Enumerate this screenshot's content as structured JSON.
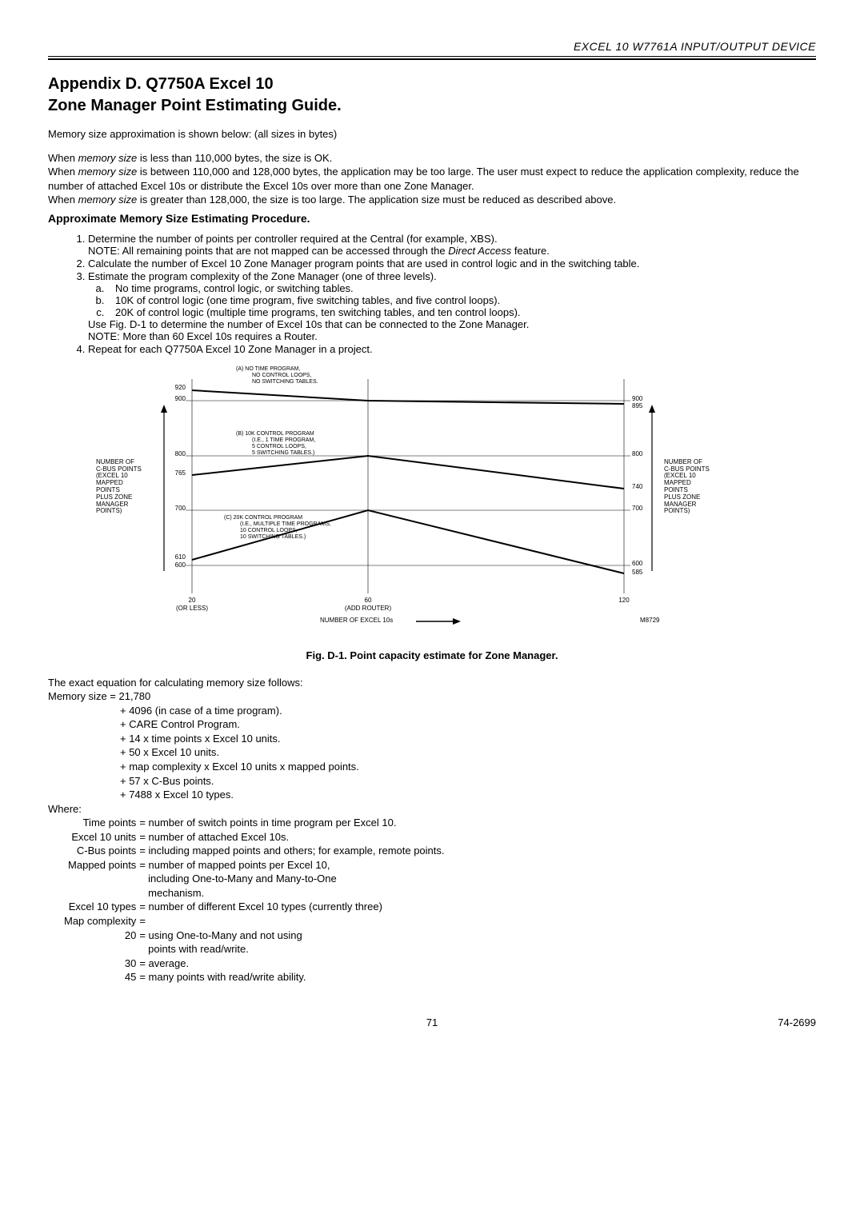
{
  "header": {
    "doc_title": "EXCEL 10 W7761A INPUT/OUTPUT DEVICE"
  },
  "title": {
    "l1": "Appendix D. Q7750A Excel 10",
    "l2": "Zone Manager Point Estimating Guide."
  },
  "intro": "Memory size approximation is shown below: (all sizes in bytes)",
  "mem": {
    "p1a": "When ",
    "p1i": "memory size",
    "p1b": " is less than 110,000 bytes, the size is OK.",
    "p2a": "When ",
    "p2i": "memory size",
    "p2b": " is between 110,000 and 128,000 bytes, the application may be too large. The user must expect to reduce the application complexity, reduce the number of attached Excel 10s or distribute the Excel 10s over more than one Zone Manager.",
    "p3a": "When ",
    "p3i": "memory size",
    "p3b": " is greater than 128,000, the size is too large. The application size must be reduced as described above."
  },
  "subheading": "Approximate Memory Size Estimating Procedure.",
  "steps": {
    "s1": "Determine the number of points per controller required at the Central (for example, XBS).",
    "s1_note_a": "NOTE:   All remaining points that are not mapped can be accessed through the ",
    "s1_note_i": "Direct Access",
    "s1_note_b": " feature.",
    "s2": "Calculate the number of Excel 10 Zone Manager program points that are used in control logic and in the switching table.",
    "s3": "Estimate the program complexity of the Zone Manager (one of three levels).",
    "s3a": "No time programs, control logic, or switching tables.",
    "s3b": "10K of control logic (one time program, five switching tables, and five control loops).",
    "s3c": "20K of control logic (multiple time programs, ten switching tables, and ten control loops).",
    "s3_use": "Use Fig. D-1 to determine the number of Excel 10s that can be connected to the Zone Manager.",
    "s3_note": "NOTE:   More than 60 Excel 10s requires a Router.",
    "s4": "Repeat for each Q7750A Excel 10 Zone Manager in a project."
  },
  "figure_caption": "Fig. D-1. Point capacity estimate for Zone Manager.",
  "equation": {
    "lead": "The exact equation for calculating memory size follows:",
    "l0": "Memory size = 21,780",
    "l1": "+ 4096 (in case of a time program).",
    "l2": "+ CARE Control Program.",
    "l3": "+ 14 x time points x Excel 10 units.",
    "l4": "+ 50 x Excel 10 units.",
    "l5": "+ map complexity x Excel 10 units x mapped points.",
    "l6": "+ 57 x C-Bus points.",
    "l7": "+ 7488 x Excel 10 types."
  },
  "where_heading": "Where:",
  "where": {
    "time_points": {
      "lbl": "Time points",
      "def": "= number of switch points in time program per Excel 10."
    },
    "excel10_units": {
      "lbl": "Excel 10 units",
      "def": "= number of attached Excel 10s."
    },
    "cbus_points": {
      "lbl": "C-Bus points",
      "def": "= including mapped points and others; for example, remote points."
    },
    "mapped_points": {
      "lbl": "Mapped points",
      "def": "= number of mapped points per Excel 10,",
      "def2": "including One-to-Many and Many-to-One",
      "def3": "mechanism."
    },
    "excel10_types": {
      "lbl": "Excel 10 types",
      "def": "= number of different Excel 10 types (currently three)"
    },
    "map_complexity": {
      "lbl": "Map complexity",
      "def": "="
    },
    "mc20": {
      "lbl": "20",
      "def": "= using One-to-Many and not using",
      "def2": "points with read/write."
    },
    "mc30": {
      "lbl": "30",
      "def": "= average."
    },
    "mc45": {
      "lbl": "45",
      "def": "= many points with read/write ability."
    }
  },
  "footer": {
    "page": "71",
    "docnum": "74-2699"
  },
  "chart_data": {
    "type": "line",
    "xlabel": "NUMBER OF EXCEL 10s",
    "ylabel_left": "NUMBER OF C-BUS POINTS (EXCEL 10 MAPPED POINTS PLUS ZONE MANAGER POINTS)",
    "ylabel_right": "NUMBER OF C-BUS POINTS (EXCEL 10 MAPPED POINTS PLUS ZONE MANAGER POINTS)",
    "x_ticks": [
      20,
      60,
      120
    ],
    "x_tick_labels_extra": {
      "20": "(OR LESS)",
      "60": "(ADD ROUTER)"
    },
    "y_ticks_left": [
      600,
      610,
      700,
      765,
      800,
      900,
      920
    ],
    "y_ticks_right": [
      585,
      600,
      700,
      740,
      800,
      895,
      900
    ],
    "series": [
      {
        "name": "A",
        "label": "(A)  NO TIME PROGRAM, NO CONTROL LOOPS, NO SWITCHING TABLES.",
        "points": [
          [
            20,
            920
          ],
          [
            60,
            900
          ],
          [
            120,
            895
          ]
        ]
      },
      {
        "name": "B",
        "label": "(B)  10K CONTROL PROGRAM (I.E., 1 TIME PROGRAM, 5 CONTROL LOOPS, 5 SWITCHING TABLES.)",
        "points": [
          [
            20,
            765
          ],
          [
            60,
            800
          ],
          [
            120,
            740
          ]
        ]
      },
      {
        "name": "C",
        "label": "(C)  20K CONTROL PROGRAM (I.E., MULTIPLE TIME PROGRAMS, 10 CONTROL LOOPS, 10 SWITCHING TABLES.)",
        "points": [
          [
            20,
            610
          ],
          [
            60,
            700
          ],
          [
            120,
            585
          ]
        ]
      }
    ],
    "ylim": [
      560,
      940
    ],
    "figure_id": "M8729"
  },
  "chart_text": {
    "ann_a_l1": "(A)   NO TIME PROGRAM,",
    "ann_a_l2": "NO CONTROL LOOPS,",
    "ann_a_l3": "NO SWITCHING TABLES.",
    "ann_b_l1": "(B)   10K CONTROL PROGRAM",
    "ann_b_l2": "(I.E., 1 TIME PROGRAM,",
    "ann_b_l3": "5 CONTROL LOOPS,",
    "ann_b_l4": "5 SWITCHING TABLES.)",
    "ann_c_l1": "(C)   20K CONTROL PROGRAM",
    "ann_c_l2": "(I.E., MULTIPLE TIME PROGRAMS,",
    "ann_c_l3": "10 CONTROL LOOPS,",
    "ann_c_l4": "10 SWITCHING TABLES.)",
    "yl_l1": "NUMBER OF",
    "yl_l2": "C-BUS POINTS",
    "yl_l3": "(EXCEL 10",
    "yl_l4": "MAPPED",
    "yl_l5": "POINTS",
    "yl_l6": "PLUS ZONE",
    "yl_l7": "MANAGER",
    "yl_l8": "POINTS)",
    "x20": "20",
    "x20b": "(OR LESS)",
    "x60": "60",
    "x60b": "(ADD ROUTER)",
    "x120": "120",
    "yL920": "920",
    "yL900": "900",
    "yL800": "800",
    "yL765": "765",
    "yL700": "700",
    "yL610": "610",
    "yL600": "600",
    "yR900": "900",
    "yR895": "895",
    "yR800": "800",
    "yR740": "740",
    "yR700": "700",
    "yR600": "600",
    "yR585": "585",
    "xaxis": "NUMBER OF EXCEL 10s",
    "figid": "M8729"
  }
}
